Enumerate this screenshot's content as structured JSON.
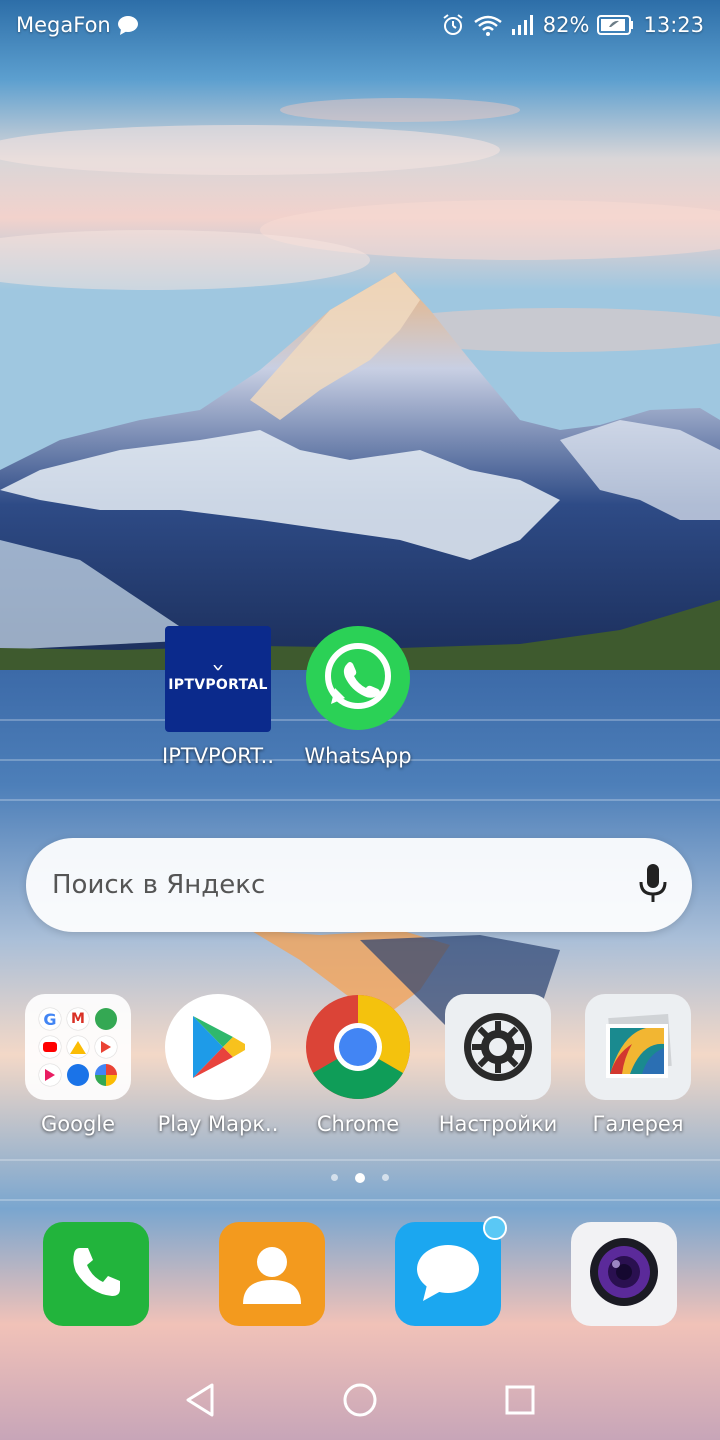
{
  "status_bar": {
    "carrier": "MegaFon",
    "battery_percent": "82%",
    "time": "13:23"
  },
  "home_apps": [
    {
      "label": "IPTVPORT..",
      "icon": "iptv-portal-icon"
    },
    {
      "label": "WhatsApp",
      "icon": "whatsapp-icon"
    }
  ],
  "iptv_logo_text": "IPTVPORTAL",
  "search": {
    "placeholder": "Поиск в Яндекс"
  },
  "row_apps": [
    {
      "label": "Google",
      "icon": "google-folder-icon"
    },
    {
      "label": "Play Марк..",
      "icon": "play-store-icon"
    },
    {
      "label": "Chrome",
      "icon": "chrome-icon"
    },
    {
      "label": "Настройки",
      "icon": "settings-gear-icon"
    },
    {
      "label": "Галерея",
      "icon": "gallery-icon"
    }
  ],
  "pages": {
    "count": 3,
    "active_index": 1
  },
  "dock": [
    {
      "icon": "phone-icon"
    },
    {
      "icon": "contacts-icon"
    },
    {
      "icon": "messages-icon"
    },
    {
      "icon": "camera-icon"
    }
  ],
  "colors": {
    "phone": "#22b43c",
    "contacts": "#f39a1e",
    "messages": "#1ba7f0",
    "whatsapp": "#2bd156",
    "iptv_bg": "#0b2a8c",
    "badge": "#5ac8f5"
  }
}
